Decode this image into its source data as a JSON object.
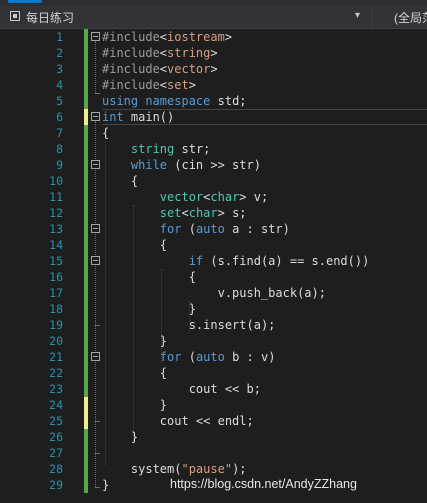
{
  "navigation": {
    "project_name": "每日练习",
    "scope_label": "(全局范",
    "project_icon": "project-icon",
    "dropdown_icon": "chevron-down-icon"
  },
  "editor": {
    "line_numbers": [
      "1",
      "2",
      "3",
      "4",
      "5",
      "6",
      "7",
      "8",
      "9",
      "10",
      "11",
      "12",
      "13",
      "14",
      "15",
      "16",
      "17",
      "18",
      "19",
      "20",
      "21",
      "22",
      "23",
      "24",
      "25",
      "26",
      "27",
      "28",
      "29"
    ],
    "code_lines": [
      "#include<iostream>",
      "#include<string>",
      "#include<vector>",
      "#include<set>",
      "using namespace std;",
      "int main()",
      "{",
      "    string str;",
      "    while (cin >> str)",
      "    {",
      "        vector<char> v;",
      "        set<char> s;",
      "        for (auto a : str)",
      "        {",
      "            if (s.find(a) == s.end())",
      "            {",
      "                v.push_back(a);",
      "            }",
      "            s.insert(a);",
      "        }",
      "        for (auto b : v)",
      "        {",
      "            cout << b;",
      "        }",
      "        cout << endl;",
      "    }",
      "",
      "    system(\"pause\");",
      "}"
    ],
    "change_markers": [
      "saved",
      "saved",
      "saved",
      "saved",
      "saved",
      "dirty",
      "saved",
      "saved",
      "saved",
      "saved",
      "saved",
      "saved",
      "saved",
      "saved",
      "saved",
      "saved",
      "saved",
      "saved",
      "saved",
      "saved",
      "saved",
      "saved",
      "saved",
      "dirty",
      "dirty",
      "saved",
      "saved",
      "saved",
      "saved"
    ],
    "colors": {
      "keyword": "#569cd6",
      "type": "#4ec9b0",
      "preprocessor": "#9b9b9b",
      "string": "#d69d85",
      "line_number": "#2b91af",
      "saved_change": "#57a64a",
      "unsaved_change": "#efef91"
    }
  },
  "watermark": "https://blog.csdn.net/AndyZZhang"
}
